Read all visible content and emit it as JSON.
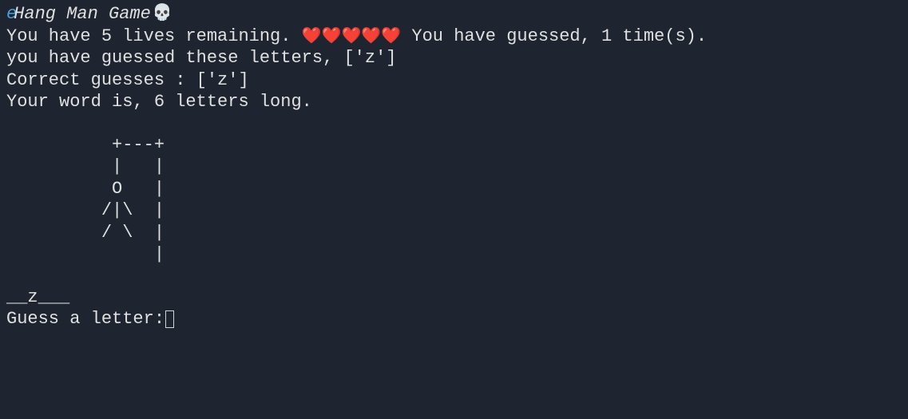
{
  "title": {
    "left_icon_glyph": "e",
    "text": "Hang Man Game",
    "skull_glyph": "💀"
  },
  "status": {
    "lives_text": "You have 5  lives remaining.",
    "hearts": "❤️❤️❤️❤️❤️",
    "guesses_text": "You have guessed, 1 time(s)."
  },
  "guessed_letters_line": "you have guessed these letters, ['z']",
  "correct_guesses_line": "Correct guesses : ['z']",
  "word_length_line": "Your word is, 6 letters long.",
  "gallows_ascii": "          +---+\n          |   |\n          O   |\n         /|\\  |\n         / \\  |\n              |",
  "word_progress": "__z___",
  "prompt_label": "Guess a letter:",
  "game_state": {
    "lives_remaining": 5,
    "guess_count": 1,
    "guessed_letters": [
      "z"
    ],
    "correct_guesses": [
      "z"
    ],
    "word_length": 6,
    "revealed": [
      "_",
      "_",
      "z",
      "_",
      "_",
      "_"
    ]
  }
}
